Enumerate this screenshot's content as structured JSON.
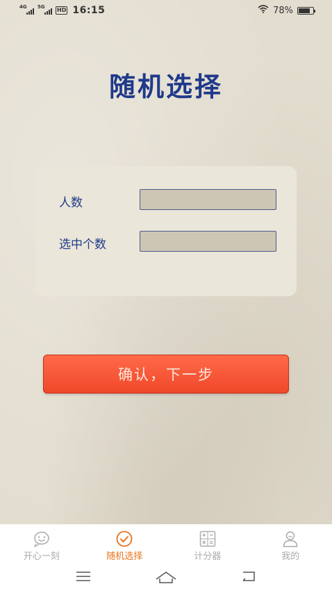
{
  "status_bar": {
    "signal1_label": "4G",
    "signal2_label": "5G",
    "hd_label": "HD",
    "time": "16:15",
    "battery": "78%",
    "battery_level": 0.78
  },
  "page": {
    "title": "随机选择"
  },
  "form": {
    "people_label": "人数",
    "people_value": "",
    "selected_label": "选中个数",
    "selected_value": ""
  },
  "confirm_button": {
    "label": "确认，下一步"
  },
  "tabs": [
    {
      "label": "开心一刻",
      "icon": "smiley-icon",
      "active": false
    },
    {
      "label": "随机选择",
      "icon": "check-circle-icon",
      "active": true
    },
    {
      "label": "计分器",
      "icon": "calculator-icon",
      "active": false
    },
    {
      "label": "我的",
      "icon": "user-icon",
      "active": false
    }
  ],
  "colors": {
    "title": "#1f3a8a",
    "button": "#f0482a",
    "active_tab": "#e8721c",
    "inactive_tab": "#aaaaaa"
  },
  "nav_bar": {
    "menu_icon": "menu-icon",
    "home_icon": "home-icon",
    "back_icon": "back-icon"
  }
}
